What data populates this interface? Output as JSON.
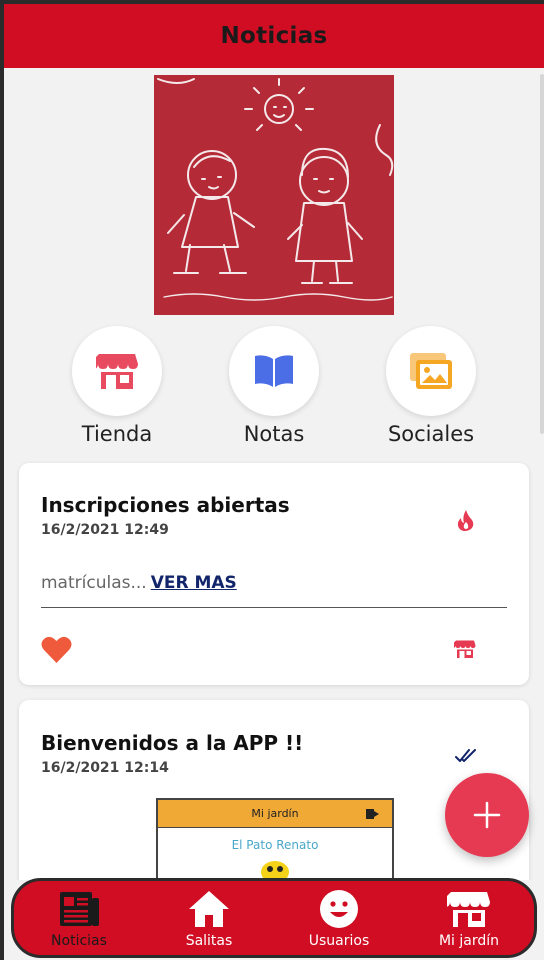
{
  "header": {
    "title": "Noticias"
  },
  "quick_links": [
    {
      "label": "Tienda",
      "icon": "store-icon",
      "color": "#e84a5f"
    },
    {
      "label": "Notas",
      "icon": "book-icon",
      "color": "#4b6de6"
    },
    {
      "label": "Sociales",
      "icon": "images-icon",
      "color": "#f5a623"
    }
  ],
  "posts": [
    {
      "title": "Inscripciones abiertas",
      "date": "16/2/2021 12:49",
      "excerpt": "matrículas...",
      "more_label": "VER MAS",
      "status_icon": "fire-icon",
      "like_icon": "heart-icon",
      "source_icon": "store-icon"
    },
    {
      "title": "Bienvenidos a la APP !!",
      "date": "16/2/2021 12:14",
      "status_icon": "double-check-icon",
      "preview": {
        "bar_title": "Mi jardín",
        "name": "El Pato Renato"
      }
    }
  ],
  "fab": {
    "icon": "plus-icon"
  },
  "bottom_nav": [
    {
      "label": "Noticias",
      "icon": "newspaper-icon",
      "active": true
    },
    {
      "label": "Salitas",
      "icon": "home-icon",
      "active": false
    },
    {
      "label": "Usuarios",
      "icon": "smiley-icon",
      "active": false
    },
    {
      "label": "Mi jardín",
      "icon": "store-icon",
      "active": false
    }
  ],
  "colors": {
    "brand": "#d00d22",
    "accent": "#e63a52",
    "link": "#12256b"
  }
}
